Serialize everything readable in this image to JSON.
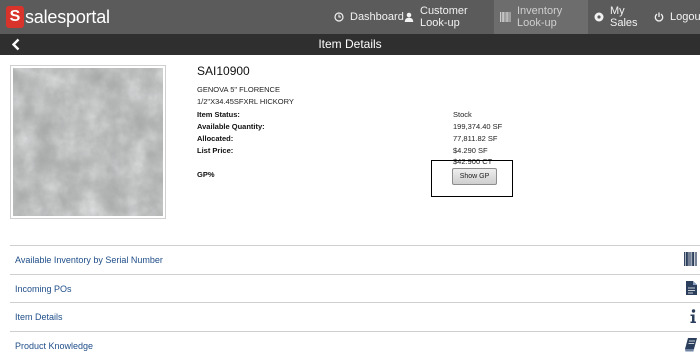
{
  "brand": {
    "letter": "S",
    "name": "salesportal"
  },
  "nav": {
    "items": [
      {
        "label": "Dashboard",
        "icon": "clock-icon",
        "active": false
      },
      {
        "label": "Customer Look-up",
        "icon": "person-icon",
        "active": false
      },
      {
        "label": "Inventory Look-up",
        "icon": "barcode-icon",
        "active": true
      },
      {
        "label": "My Sales",
        "icon": "circle-dot-icon",
        "active": false
      },
      {
        "label": "Logout",
        "icon": "power-icon",
        "active": false
      }
    ]
  },
  "titlebar": {
    "title": "Item Details",
    "back_icon": "chevron-left-icon"
  },
  "item": {
    "sku": "SAI10900",
    "description_line1": "GENOVA 5\" FLORENCE",
    "description_line2": "1/2\"X34.45SFXRL HICKORY",
    "fields": [
      {
        "label": "Item Status:",
        "value": "Stock"
      },
      {
        "label": "Available Quantity:",
        "value": "199,374.40 SF"
      },
      {
        "label": "Allocated:",
        "value": "77,811.82 SF"
      },
      {
        "label": "List Price:",
        "value": "$4.290 SF"
      }
    ],
    "list_price_alt": "$42.900 CT",
    "gp_label": "GP%",
    "show_gp_label": "Show GP"
  },
  "sections": [
    {
      "label": "Available Inventory by Serial Number",
      "icon": "barcode-icon"
    },
    {
      "label": "Incoming POs",
      "icon": "document-icon"
    },
    {
      "label": "Item Details",
      "icon": "info-icon"
    },
    {
      "label": "Product Knowledge",
      "icon": "book-icon"
    }
  ],
  "colors": {
    "nav_bg": "#5b5b5b",
    "title_bg": "#2f2f2f",
    "brand_red": "#d9342b",
    "link": "#1f4e8a"
  }
}
